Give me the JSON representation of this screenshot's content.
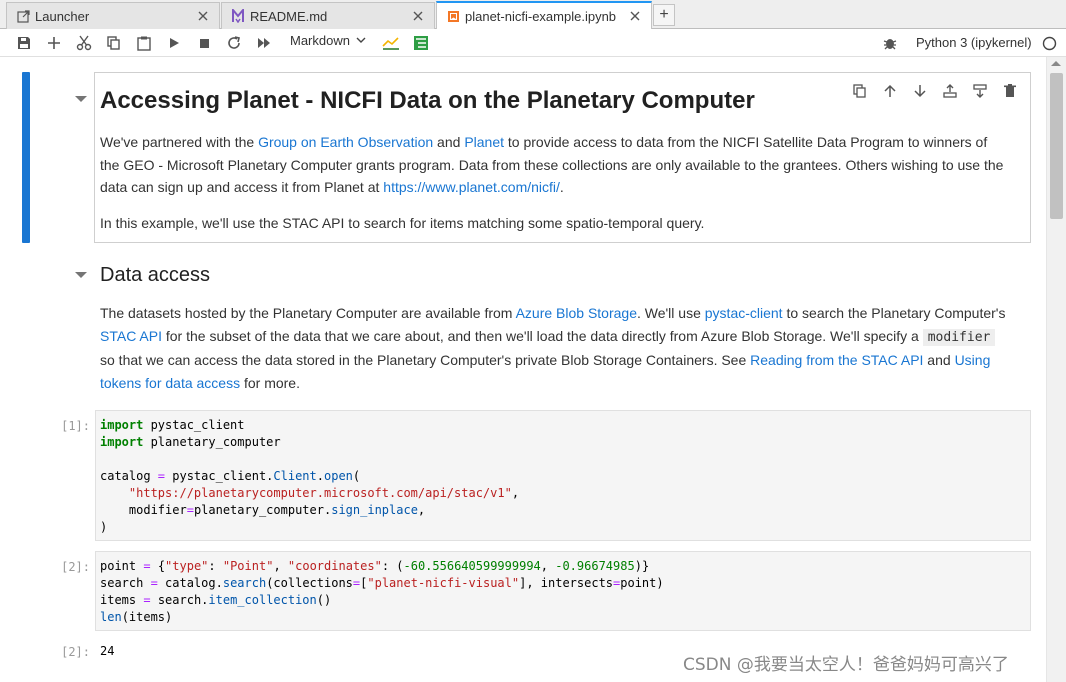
{
  "tabs": [
    {
      "label": "Launcher",
      "icon": "launcher-icon",
      "close": "×"
    },
    {
      "label": "README.md",
      "icon": "markdown-icon",
      "close": "×"
    },
    {
      "label": "planet-nicfi-example.ipynb",
      "icon": "notebook-icon",
      "close": "×"
    }
  ],
  "new_tab": "+",
  "toolbar": {
    "cell_type": "Markdown",
    "kernel": "Python 3 (ipykernel)"
  },
  "cell1": {
    "title": "Accessing Planet - NICFI Data on the Planetary Computer",
    "p1_a": "We've partnered with the ",
    "link_geo": "Group on Earth Observation",
    "p1_b": " and ",
    "link_planet": "Planet",
    "p1_c": " to provide access to data from the NICFI Satellite Data Program to winners of the GEO - Microsoft Planetary Computer grants program. Data from these collections are only available to the grantees. Others wishing to use the data can sign up and access it from Planet at ",
    "link_url": "https://www.planet.com/nicfi/",
    "p1_d": ".",
    "p2": "In this example, we'll use the STAC API to search for items matching some spatio-temporal query."
  },
  "cell2": {
    "title": "Data access",
    "p_a": "The datasets hosted by the Planetary Computer are available from ",
    "link_blob": "Azure Blob Storage",
    "p_b": ". We'll use ",
    "link_pystac": "pystac-client",
    "p_c": " to search the Planetary Computer's ",
    "link_stac": "STAC API",
    "p_d": " for the subset of the data that we care about, and then we'll load the data directly from Azure Blob Storage. We'll specify a ",
    "code_modifier": "modifier",
    "p_e": " so that we can access the data stored in the Planetary Computer's private Blob Storage Containers. See ",
    "link_reading": "Reading from the STAC API",
    "p_f": " and ",
    "link_tokens": "Using tokens for data access",
    "p_g": " for more."
  },
  "code1": {
    "prompt": "[1]:",
    "l1_kw": "import",
    "l1_rest": " pystac_client",
    "l2_kw": "import",
    "l2_rest": " planetary_computer",
    "l4_a": "catalog ",
    "l4_op": "=",
    "l4_b": " pystac_client.",
    "l4_fn1": "Client",
    "l4_c": ".",
    "l4_fn2": "open",
    "l4_d": "(",
    "l5_str": "\"https://planetarycomputer.microsoft.com/api/stac/v1\"",
    "l5_end": ",",
    "l6_a": "    modifier",
    "l6_op": "=",
    "l6_b": "planetary_computer.",
    "l6_fn": "sign_inplace",
    "l6_end": ",",
    "l7": ")"
  },
  "code2": {
    "prompt": "[2]:",
    "l1_a": "point ",
    "l1_op": "=",
    "l1_b": " {",
    "l1_s1": "\"type\"",
    "l1_c": ": ",
    "l1_s2": "\"Point\"",
    "l1_d": ", ",
    "l1_s3": "\"coordinates\"",
    "l1_e": ": (",
    "l1_n1": "-60.556640599999994",
    "l1_f": ", ",
    "l1_n2": "-0.96674985",
    "l1_g": ")}",
    "l2_a": "search ",
    "l2_op": "=",
    "l2_b": " catalog.",
    "l2_fn": "search",
    "l2_c": "(collections",
    "l2_op2": "=",
    "l2_d": "[",
    "l2_s": "\"planet-nicfi-visual\"",
    "l2_e": "], intersects",
    "l2_op3": "=",
    "l2_f": "point)",
    "l3_a": "items ",
    "l3_op": "=",
    "l3_b": " search.",
    "l3_fn": "item_collection",
    "l3_c": "()",
    "l4_fn": "len",
    "l4_c": "(items)"
  },
  "output2": {
    "prompt": "[2]:",
    "value": "24"
  },
  "watermark": "CSDN @我要当太空人！爸爸妈妈可高兴了"
}
